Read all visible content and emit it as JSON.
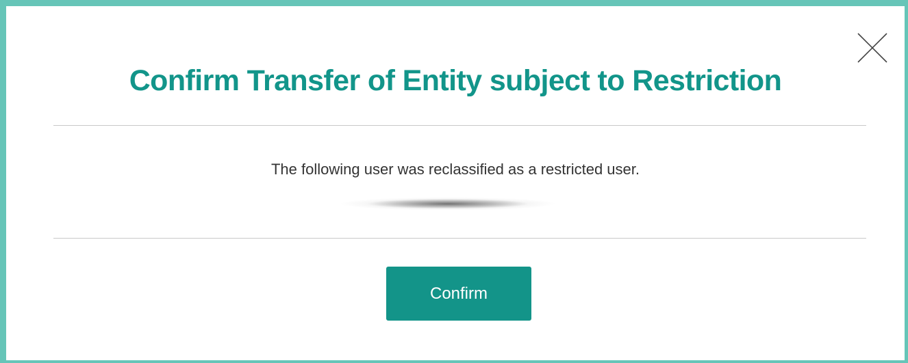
{
  "dialog": {
    "title": "Confirm Transfer of Entity subject to Restriction",
    "message": "The following user was reclassified as a restricted user.",
    "redacted_user": "",
    "confirm_label": "Confirm",
    "close_icon": "close-icon"
  },
  "colors": {
    "accent": "#12958a",
    "border": "#66c5b8",
    "button": "#139489",
    "divider": "#c8c8c8",
    "text": "#333333"
  }
}
